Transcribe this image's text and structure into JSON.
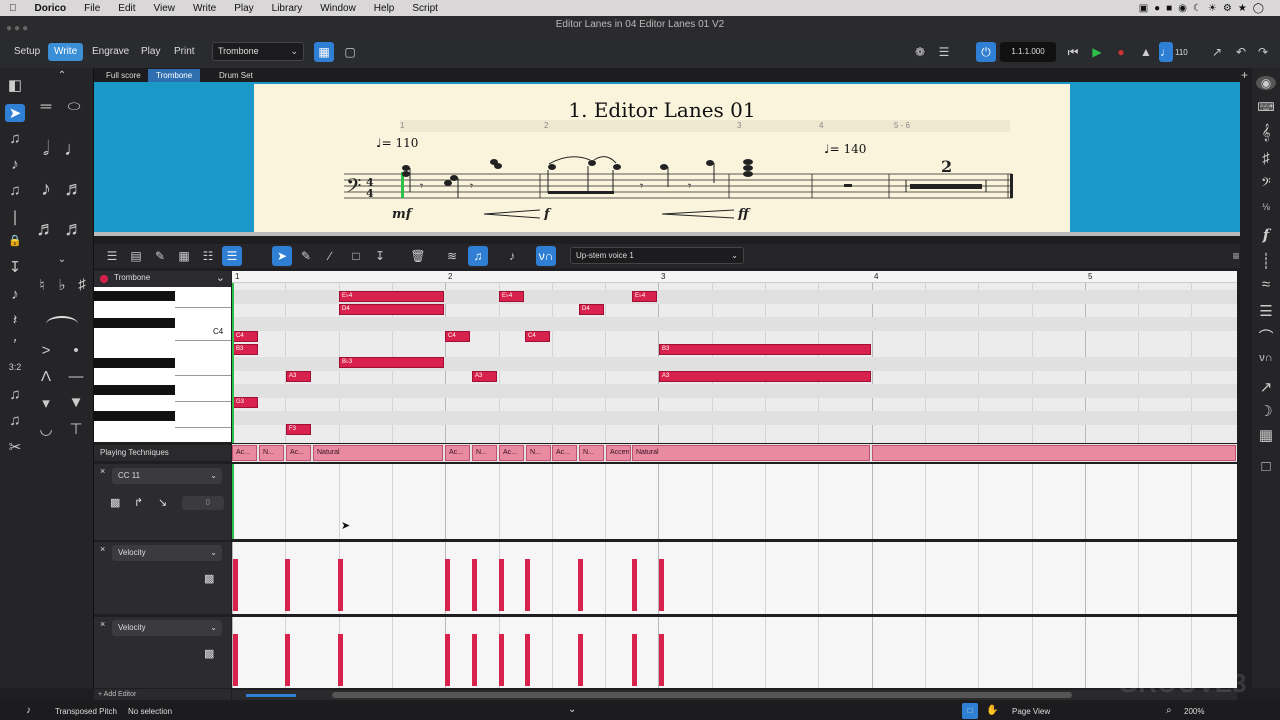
{
  "menubar": {
    "app": "Dorico",
    "items": [
      "File",
      "Edit",
      "View",
      "Write",
      "Play",
      "Library",
      "Window",
      "Help",
      "Script"
    ]
  },
  "window": {
    "title": "Editor Lanes in 04 Editor Lanes 01 V2"
  },
  "toolbar": {
    "modes": [
      "Setup",
      "Write",
      "Engrave",
      "Play",
      "Print"
    ],
    "active_mode": "Write",
    "layout_select": "Trombone",
    "position": "1.1.1.000",
    "tempo": "110"
  },
  "tabs": [
    {
      "label": "Full score",
      "active": false
    },
    {
      "label": "Trombone",
      "active": true
    },
    {
      "label": "Drum Set",
      "active": false
    }
  ],
  "score": {
    "title": "1. Editor Lanes 01",
    "bar_numbers": [
      "1",
      "2",
      "3",
      "4",
      "5 - 6"
    ],
    "tempo_marks": [
      "♩= 110",
      "♩= 140"
    ],
    "dynamics": [
      "mf",
      "f",
      "ff"
    ],
    "multirest": "2"
  },
  "key_editor": {
    "voice_select": "Up-stem voice 1",
    "track_name": "Trombone",
    "c4_label": "C4",
    "ruler": [
      "1",
      "2",
      "3",
      "4",
      "5"
    ],
    "notes": [
      {
        "pitch": "E♭4"
      },
      {
        "pitch": "D4"
      },
      {
        "pitch": "E♭4"
      },
      {
        "pitch": "D4"
      },
      {
        "pitch": "E♭4"
      },
      {
        "pitch": "C4"
      },
      {
        "pitch": "B3"
      },
      {
        "pitch": "C4"
      },
      {
        "pitch": "C4"
      },
      {
        "pitch": "B♭3"
      },
      {
        "pitch": "B3"
      },
      {
        "pitch": "A3"
      },
      {
        "pitch": "A3"
      },
      {
        "pitch": "A3"
      },
      {
        "pitch": "G3"
      },
      {
        "pitch": "F3"
      }
    ],
    "playing_techniques_label": "Playing Techniques",
    "playing_techniques": [
      "Ac...",
      "N...",
      "Ac...",
      "Natural",
      "Ac...",
      "N...",
      "Ac...",
      "N...",
      "Ac...",
      "N...",
      "Accent",
      "Natural"
    ],
    "lanes": [
      {
        "name": "CC 11",
        "value": "0"
      },
      {
        "name": "Velocity"
      },
      {
        "name": "Velocity"
      }
    ],
    "add_editor": "+ Add Editor"
  },
  "statusbar": {
    "pitch_mode": "Transposed Pitch",
    "selection": "No selection",
    "view": "Page View",
    "zoom": "200%"
  },
  "watermark": "GROOVE3",
  "colors": {
    "accent": "#2f7fd4",
    "note": "#d8224d",
    "paper": "#fbf4dd",
    "score_bg": "#1a98c8"
  }
}
